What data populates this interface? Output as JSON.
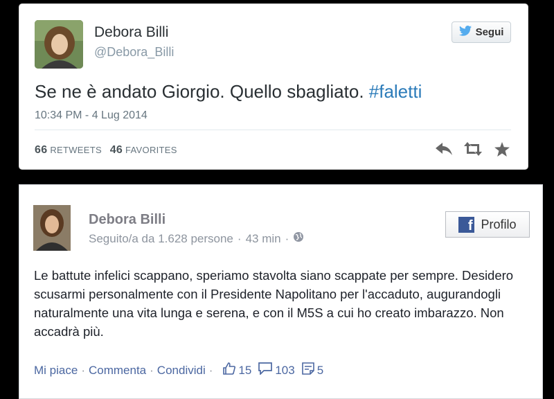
{
  "twitter": {
    "name": "Debora Billi",
    "handle": "@Debora_Billi",
    "follow_label": "Segui",
    "tweet_text": "Se ne è andato Giorgio. Quello sbagliato. ",
    "hashtag": "#faletti",
    "timestamp": "10:34 PM - 4 Lug 2014",
    "retweets_count": "66",
    "retweets_label": "RETWEETS",
    "favorites_count": "46",
    "favorites_label": "FAVORITES",
    "colors": {
      "hashtag": "#2b7bb9",
      "bird": "#55acee"
    }
  },
  "facebook": {
    "name": "Debora Billi",
    "followers": "Seguito/a da 1.628 persone",
    "time": "43 min",
    "profile_label": "Profilo",
    "post_text": "Le battute infelici scappano, speriamo stavolta siano scappate per sempre. Desidero scusarmi personalmente con il Presidente Napolitano per l'accaduto, augurandogli naturalmente una vita lunga e serena, e con il M5S a cui ho creato imbarazzo. Non accadrà più.",
    "like_label": "Mi piace",
    "comment_label": "Commenta",
    "share_label": "Condividi",
    "separator": "·",
    "likes_count": "15",
    "comments_count": "103",
    "shares_count": "5",
    "colors": {
      "brand": "#3b5998",
      "link": "#4b67a1"
    }
  }
}
